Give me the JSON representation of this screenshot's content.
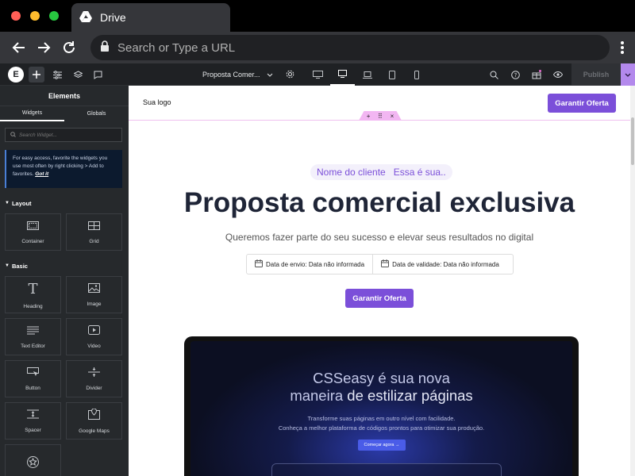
{
  "browser": {
    "tab_title": "Drive",
    "url_placeholder": "Search or Type a URL"
  },
  "editor_toolbar": {
    "page_name": "Proposta Comer...",
    "publish_label": "Publish"
  },
  "sidebar": {
    "title": "Elements",
    "tabs": [
      "Widgets",
      "Globals"
    ],
    "search_placeholder": "Search Widget...",
    "tip_text": "For easy access, favorite the widgets you use most often by right clicking > Add to favorites.",
    "tip_link": "Got it",
    "categories": [
      {
        "name": "Layout",
        "widgets": [
          "Container",
          "Grid"
        ]
      },
      {
        "name": "Basic",
        "widgets": [
          "Heading",
          "Image",
          "Text Editor",
          "Video",
          "Button",
          "Divider",
          "Spacer",
          "Google Maps"
        ]
      }
    ]
  },
  "page": {
    "logo_text": "Sua logo",
    "cta_top": "Garantir Oferta",
    "pill_client": "Nome do cliente",
    "pill_desc": "Essa é sua..",
    "hero_title": "Proposta comercial exclusiva",
    "subtitle": "Queremos fazer parte do seu sucesso e elevar seus resultados no digital",
    "date_send": "Data de envio: Data não informada",
    "date_valid": "Data de validade: Data não informada",
    "cta_mid": "Garantir Oferta",
    "laptop": {
      "title_line1": "CSSeasy é sua nova",
      "title_line2_a": "maneira ",
      "title_line2_b": "de estilizar páginas",
      "desc_line1": "Transforme suas páginas em outro nível com facilidade.",
      "desc_line2": "Conheça a melhor plataforma de códigos prontos para otimizar sua produção.",
      "button": "Começar agora →"
    }
  },
  "colors": {
    "accent": "#7b4fd9",
    "editor_bg": "#26292c",
    "publish_arrow": "#b389ec"
  }
}
